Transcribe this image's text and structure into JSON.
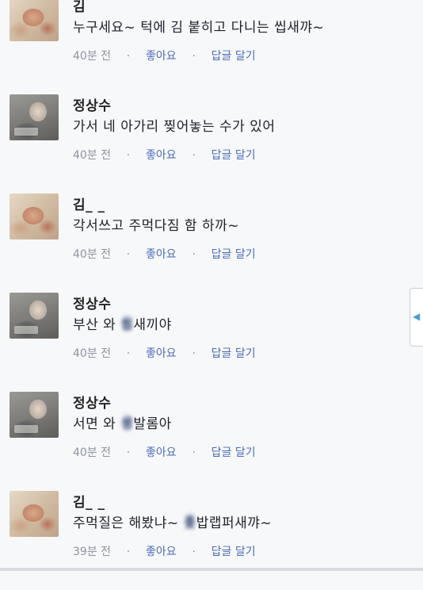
{
  "comments": [
    {
      "author": "김",
      "text": "누구세요~ 턱에 김 붙히고 다니는 씹새꺄~",
      "time": "40분 전",
      "like": "좋아요",
      "reply": "답글 달기"
    },
    {
      "author": "정상수",
      "text": "가서 네 아가리 찢어놓는 수가 있어",
      "time": "40분 전",
      "like": "좋아요",
      "reply": "답글 달기"
    },
    {
      "author": "김_ _",
      "text": "각서쓰고 주먹다짐 함 하까~",
      "time": "40분 전",
      "like": "좋아요",
      "reply": "답글 달기"
    },
    {
      "author": "정상수",
      "text_a": "부산 와 ",
      "text_b": "씹",
      "text_c": "새끼야",
      "time": "40분 전",
      "like": "좋아요",
      "reply": "답글 달기"
    },
    {
      "author": "정상수",
      "text_a": "서면 와 ",
      "text_b": "생",
      "text_c": "발롬아",
      "time": "40분 전",
      "like": "좋아요",
      "reply": "답글 달기"
    },
    {
      "author": "김_ _",
      "text_a": "주먹질은 해봤냐~ ",
      "text_b": "좆",
      "text_c": "밥랩퍼새꺄~",
      "time": "39분 전",
      "like": "좋아요",
      "reply": "답글 달기"
    }
  ],
  "separator": "·",
  "side_tab_icon": "chevron-left-icon"
}
